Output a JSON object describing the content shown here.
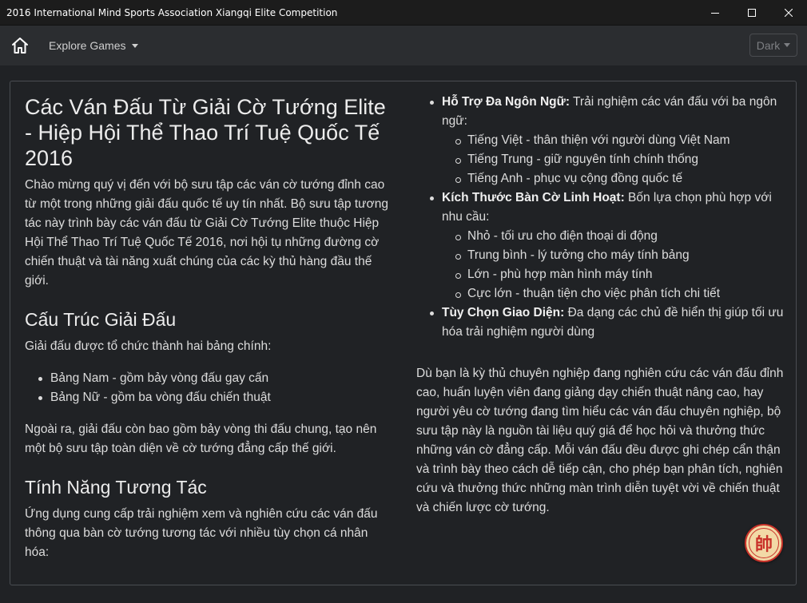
{
  "window": {
    "title": "2016 International Mind Sports Association Xiangqi Elite Competition"
  },
  "navbar": {
    "explore_label": "Explore Games",
    "theme_value": "Dark"
  },
  "content": {
    "title": "Các Ván Đấu Từ Giải Cờ Tướng Elite - Hiệp Hội Thể Thao Trí Tuệ Quốc Tế 2016",
    "intro": "Chào mừng quý vị đến với bộ sưu tập các ván cờ tướng đỉnh cao từ một trong những giải đấu quốc tế uy tín nhất. Bộ sưu tập tương tác này trình bày các ván đấu từ Giải Cờ Tướng Elite thuộc Hiệp Hội Thể Thao Trí Tuệ Quốc Tế 2016, nơi hội tụ những đường cờ chiến thuật và tài năng xuất chúng của các kỳ thủ hàng đầu thế giới.",
    "structure": {
      "heading": "Cấu Trúc Giải Đấu",
      "lead": "Giải đấu được tổ chức thành hai bảng chính:",
      "items": [
        "Bảng Nam - gồm bảy vòng đấu gay cấn",
        "Bảng Nữ - gồm ba vòng đấu chiến thuật"
      ],
      "note": "Ngoài ra, giải đấu còn bao gồm bảy vòng thi đấu chung, tạo nên một bộ sưu tập toàn diện về cờ tướng đẳng cấp thế giới."
    },
    "features": {
      "heading": "Tính Năng Tương Tác",
      "lead": "Ứng dụng cung cấp trải nghiệm xem và nghiên cứu các ván đấu thông qua bàn cờ tướng tương tác với nhiều tùy chọn cá nhân hóa:",
      "items": [
        {
          "title": "Hỗ Trợ Đa Ngôn Ngữ:",
          "text": " Trải nghiệm các ván đấu với ba ngôn ngữ:",
          "sub": [
            "Tiếng Việt - thân thiện với người dùng Việt Nam",
            "Tiếng Trung - giữ nguyên tính chính thống",
            "Tiếng Anh - phục vụ cộng đồng quốc tế"
          ]
        },
        {
          "title": "Kích Thước Bàn Cờ Linh Hoạt:",
          "text": " Bốn lựa chọn phù hợp với nhu cầu:",
          "sub": [
            "Nhỏ - tối ưu cho điện thoại di động",
            "Trung bình - lý tưởng cho máy tính bảng",
            "Lớn - phù hợp màn hình máy tính",
            "Cực lớn - thuận tiện cho việc phân tích chi tiết"
          ]
        },
        {
          "title": "Tùy Chọn Giao Diện:",
          "text": " Đa dạng các chủ đề hiển thị giúp tối ưu hóa trải nghiệm người dùng"
        }
      ]
    },
    "closing": "Dù bạn là kỳ thủ chuyên nghiệp đang nghiên cứu các ván đấu đỉnh cao, huấn luyện viên đang giảng dạy chiến thuật nâng cao, hay người yêu cờ tướng đang tìm hiểu các ván đấu chuyên nghiệp, bộ sưu tập này là nguồn tài liệu quý giá để học hỏi và thưởng thức những ván cờ đẳng cấp. Mỗi ván đấu đều được ghi chép cẩn thận và trình bày theo cách dễ tiếp cận, cho phép bạn phân tích, nghiên cứu và thưởng thức những màn trình diễn tuyệt vời về chiến thuật và chiến lược cờ tướng."
  },
  "piece_button": {
    "glyph": "帥"
  },
  "colors": {
    "background": "#202225",
    "navbar": "#2b2d30",
    "titlebar": "#1c1c1c",
    "piece_red": "#c9332a",
    "piece_face": "#f2d9a6"
  }
}
